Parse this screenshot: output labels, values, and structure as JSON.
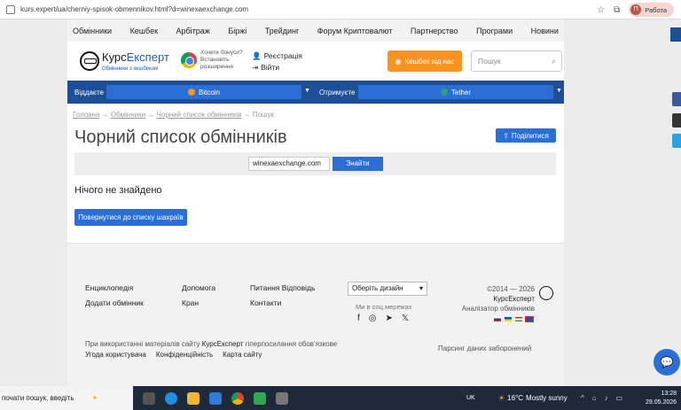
{
  "browser": {
    "url": "kurs.expert/ua/cherniy-spisok-obmennikov.html?d=winexaexchange.com",
    "profile_initial": "П",
    "profile_label": "Работа"
  },
  "topnav": {
    "items": [
      "Обмінники",
      "Кешбек",
      "Арбітраж",
      "Біржі",
      "Трейдинг",
      "Форум Криптовалют",
      "Партнерство",
      "Програми",
      "Новини"
    ]
  },
  "header": {
    "logo_main_1": "Курс",
    "logo_main_2": "Експерт",
    "logo_sub": "Обмінники з кешбеком",
    "chrome_promo_line1": "Хочете бонуси?",
    "chrome_promo_line2": "Встановіть",
    "chrome_promo_line3": "розширення",
    "register": "Реєстрація",
    "login": "Війти",
    "cashback_button": "Кешбек від нас",
    "search_placeholder": "Пошук"
  },
  "exchange": {
    "give_label": "Віддаєте",
    "give_value": "Bitcoin",
    "get_label": "Отримуєте",
    "get_value": "Tether"
  },
  "breadcrumb": {
    "home": "Головна",
    "exchangers": "Обмінники",
    "blacklist": "Чорний список обмінників",
    "current": "Пошук",
    "sep": "→"
  },
  "main": {
    "title": "Чорний список обмінників",
    "share_button": "Поділитися",
    "search_value": "winexaexchange.com",
    "search_button": "Знайти",
    "nothing_found": "Нічого не знайдено",
    "back_button": "Повернутися до списку шахраїв"
  },
  "footer": {
    "col1": [
      "Енциклопедія",
      "Додати обмінник"
    ],
    "col2": [
      "Допомога",
      "Кран"
    ],
    "col3": [
      "Питання Відповідь",
      "Контакти"
    ],
    "design_select": "Оберіть дизайн",
    "social_label": "Ми в соц.мережах",
    "copyright_1": "©2014 — 2026",
    "copyright_brand": "КурсЕксперт",
    "copyright_2": "Аналізатор обмінників",
    "legal_1": "При використанні матеріалів сайту",
    "legal_brand": "КурсЕксперт",
    "legal_2": "гіперпосилання обов'язкове",
    "legal_links": [
      "Угода користувача",
      "Конфіденційність",
      "Карта сайту"
    ],
    "parsing": "Парсинг даних заборонений"
  },
  "taskbar": {
    "search_text": "почати пошук, введіть",
    "lang": "UK",
    "temp": "16°C",
    "weather": "Mostly sunny",
    "time": "13:28",
    "date": "29.05.2026"
  },
  "colors": {
    "brand_blue": "#1c4f96",
    "button_blue": "#2a6ed6",
    "cashback_orange": "#f7931e"
  }
}
